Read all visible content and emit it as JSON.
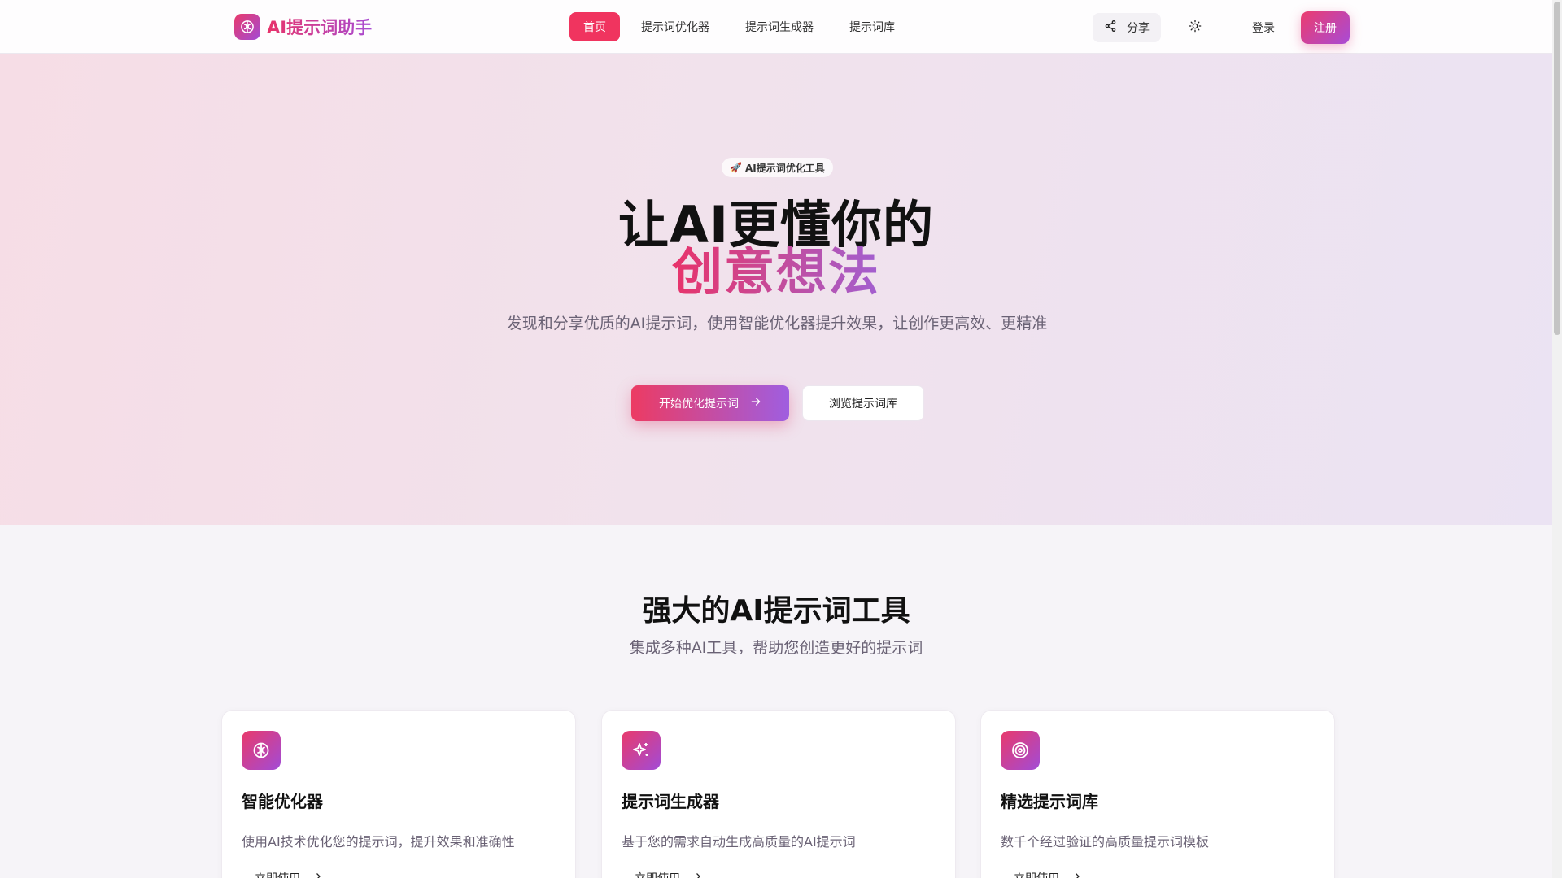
{
  "nav": {
    "brand": "AI提示词助手",
    "links": [
      "首页",
      "提示词优化器",
      "提示词生成器",
      "提示词库"
    ],
    "share_label": "分享",
    "login_label": "登录",
    "signup_label": "注册"
  },
  "hero": {
    "badge": "AI提示词优化工具",
    "title_line1": "让AI更懂你的",
    "title_line2": "创意想法",
    "subtitle": "发现和分享优质的AI提示词，使用智能优化器提升效果，让创作更高效、更精准",
    "primary_button": "开始优化提示词",
    "secondary_button": "浏览提示词库"
  },
  "features": {
    "title": "强大的AI提示词工具",
    "subtitle": "集成多种AI工具，帮助您创造更好的提示词",
    "cards": [
      {
        "icon": "brain-icon",
        "title": "智能优化器",
        "desc": "使用AI技术优化您的提示词，提升效果和准确性",
        "link": "立即使用"
      },
      {
        "icon": "sparkles-icon",
        "title": "提示词生成器",
        "desc": "基于您的需求自动生成高质量的AI提示词",
        "link": "立即使用"
      },
      {
        "icon": "target-icon",
        "title": "精选提示词库",
        "desc": "数千个经过验证的高质量提示词模板",
        "link": "立即使用"
      }
    ]
  },
  "colors": {
    "accent": "#f0345f",
    "gradient_start": "#e93a6b",
    "gradient_end": "#a24bd6"
  }
}
